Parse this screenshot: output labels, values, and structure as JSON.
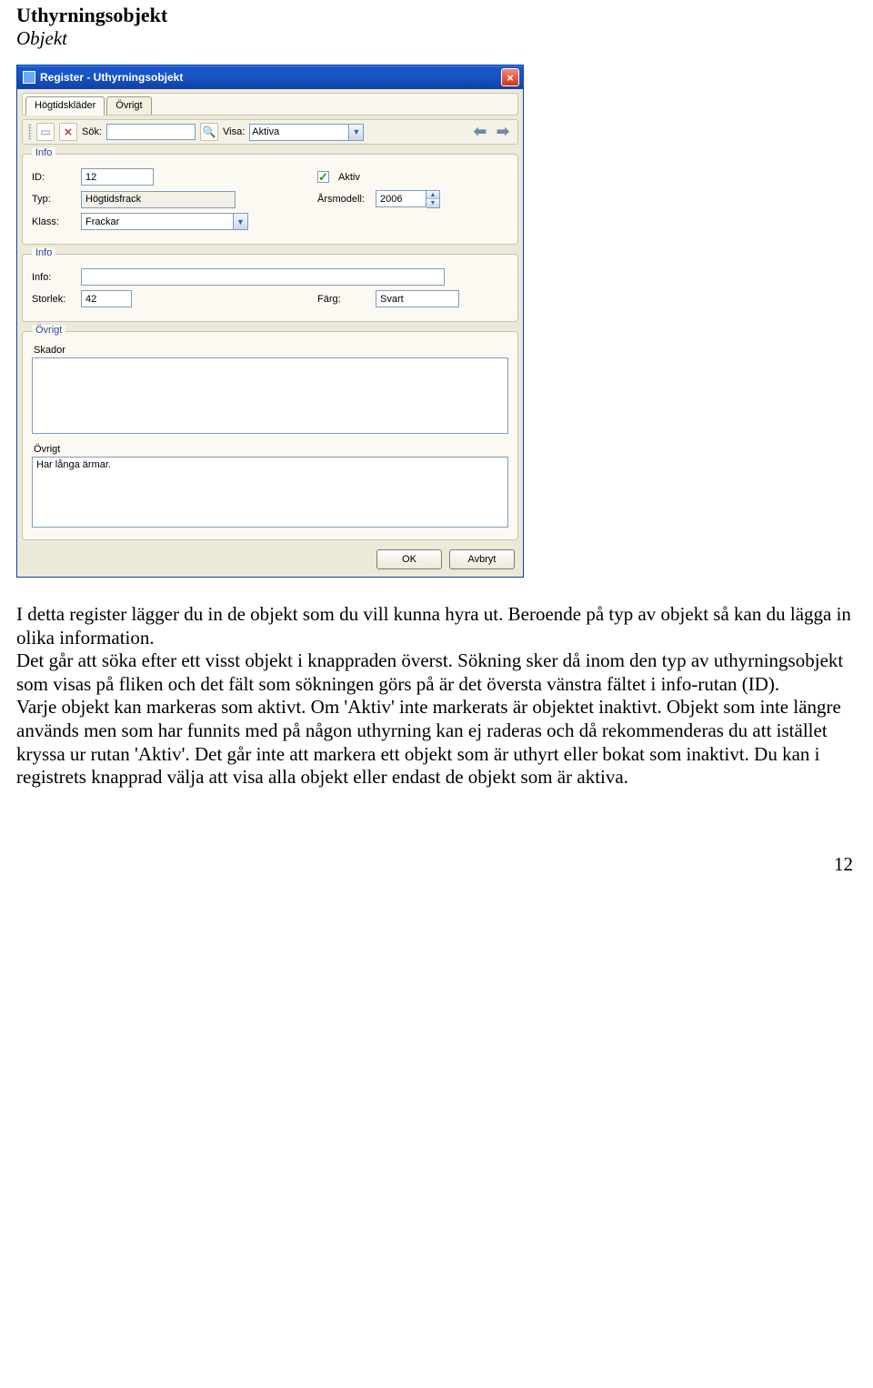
{
  "doc": {
    "heading": "Uthyrningsobjekt",
    "subheading": "Objekt",
    "body": "I detta register lägger du in de objekt som du vill kunna hyra ut. Beroende på typ av objekt så kan du lägga in olika information.\nDet går att söka efter ett visst objekt i knappraden överst. Sökning sker då inom den typ av uthyrningsobjekt som visas på fliken och det fält som sökningen görs på är det översta vänstra fältet i info-rutan (ID).\nVarje objekt kan markeras som aktivt. Om 'Aktiv' inte markerats är objektet inaktivt. Objekt som inte längre används men som har funnits med på någon uthyrning kan ej raderas och då rekommenderas du att istället kryssa ur rutan 'Aktiv'. Det går inte att markera ett objekt som är uthyrt eller bokat som inaktivt. Du kan i registrets knapprad välja att visa alla objekt eller endast de objekt som är aktiva.",
    "page_number": "12"
  },
  "window": {
    "title": "Register - Uthyrningsobjekt",
    "tabs": [
      "Högtidskläder",
      "Övrigt"
    ],
    "toolbar": {
      "sok_label": "Sök:",
      "sok_value": "",
      "visa_label": "Visa:",
      "visa_value": "Aktiva"
    },
    "group_info1": {
      "title": "Info",
      "id_label": "ID:",
      "id_value": "12",
      "aktiv_label": "Aktiv",
      "aktiv_checked": true,
      "typ_label": "Typ:",
      "typ_value": "Högtidsfrack",
      "arsmodell_label": "Årsmodell:",
      "arsmodell_value": "2006",
      "klass_label": "Klass:",
      "klass_value": "Frackar"
    },
    "group_info2": {
      "title": "Info",
      "info_label": "Info:",
      "info_value": "",
      "storlek_label": "Storlek:",
      "storlek_value": "42",
      "farg_label": "Färg:",
      "farg_value": "Svart"
    },
    "group_ovrigt": {
      "title": "Övrigt",
      "skador_label": "Skador",
      "skador_value": "",
      "ovrigt_label": "Övrigt",
      "ovrigt_value": "Har långa ärmar."
    },
    "buttons": {
      "ok": "OK",
      "avbryt": "Avbryt"
    }
  }
}
